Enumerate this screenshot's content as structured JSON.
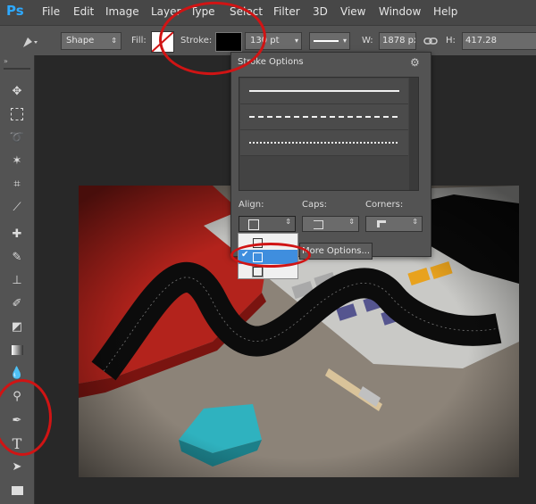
{
  "app": {
    "logo": "Ps"
  },
  "menu": [
    "File",
    "Edit",
    "Image",
    "Layer",
    "Type",
    "Select",
    "Filter",
    "3D",
    "View",
    "Window",
    "Help"
  ],
  "options_bar": {
    "mode_value": "Shape",
    "fill_label": "Fill:",
    "stroke_label": "Stroke:",
    "stroke_width_value": "130 pt",
    "width_label": "W:",
    "width_value": "1878 px",
    "height_label": "H:",
    "height_value": "417.28"
  },
  "stroke_panel": {
    "title": "Stroke Options",
    "presets": [
      "solid",
      "dashed",
      "dotted"
    ],
    "align_label": "Align:",
    "caps_label": "Caps:",
    "corners_label": "Corners:",
    "more_options_label": "More Options...",
    "align_options": [
      "inside",
      "center",
      "outside"
    ],
    "align_selected": "center"
  },
  "tools": [
    "move-tool",
    "marquee-tool",
    "lasso-tool",
    "magic-wand-tool",
    "crop-tool",
    "eyedropper-tool",
    "healing-brush-tool",
    "brush-tool",
    "clone-stamp-tool",
    "history-brush-tool",
    "eraser-tool",
    "gradient-tool",
    "blur-tool",
    "dodge-tool",
    "pen-tool",
    "type-tool",
    "path-selection-tool",
    "shape-tool"
  ],
  "colors": {
    "accent": "#2ea9ff",
    "highlight": "#3f8ede",
    "annotation": "#d01414"
  }
}
